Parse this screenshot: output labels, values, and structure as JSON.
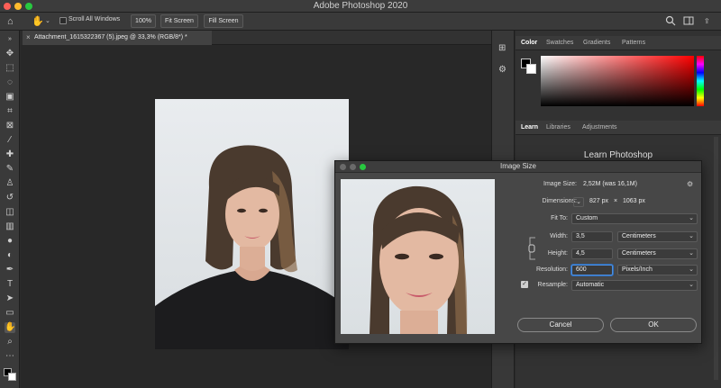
{
  "app": {
    "title": "Adobe Photoshop 2020"
  },
  "options_bar": {
    "scroll_all_windows": "Scroll All Windows",
    "zoom": "100%",
    "fit_screen": "Fit Screen",
    "fill_screen": "Fill Screen"
  },
  "document": {
    "tab_title": "Attachment_1615322367 (5).jpeg @ 33,3% (RGB/8*) *"
  },
  "panels": {
    "top_tabs": [
      "Color",
      "Swatches",
      "Gradients",
      "Patterns"
    ],
    "mid_tabs": [
      "Learn",
      "Libraries",
      "Adjustments"
    ],
    "learn_title": "Learn Photoshop"
  },
  "dialog": {
    "title": "Image Size",
    "image_size_label": "Image Size:",
    "image_size_value": "2,52M (was 16,1M)",
    "dimensions_label": "Dimensions:",
    "dim_w": "827 px",
    "dim_x": "×",
    "dim_h": "1063 px",
    "fit_to_label": "Fit To:",
    "fit_to_value": "Custom",
    "width_label": "Width:",
    "width_value": "3,5",
    "width_unit": "Centimeters",
    "height_label": "Height:",
    "height_value": "4,5",
    "height_unit": "Centimeters",
    "resolution_label": "Resolution:",
    "resolution_value": "600",
    "resolution_unit": "Pixels/Inch",
    "resample_label": "Resample:",
    "resample_value": "Automatic",
    "cancel": "Cancel",
    "ok": "OK"
  },
  "colors": {
    "accent_focus": "#4d8fe0",
    "traffic_red": "#fe5f57",
    "traffic_yellow": "#febc2e",
    "traffic_green": "#28c840"
  }
}
